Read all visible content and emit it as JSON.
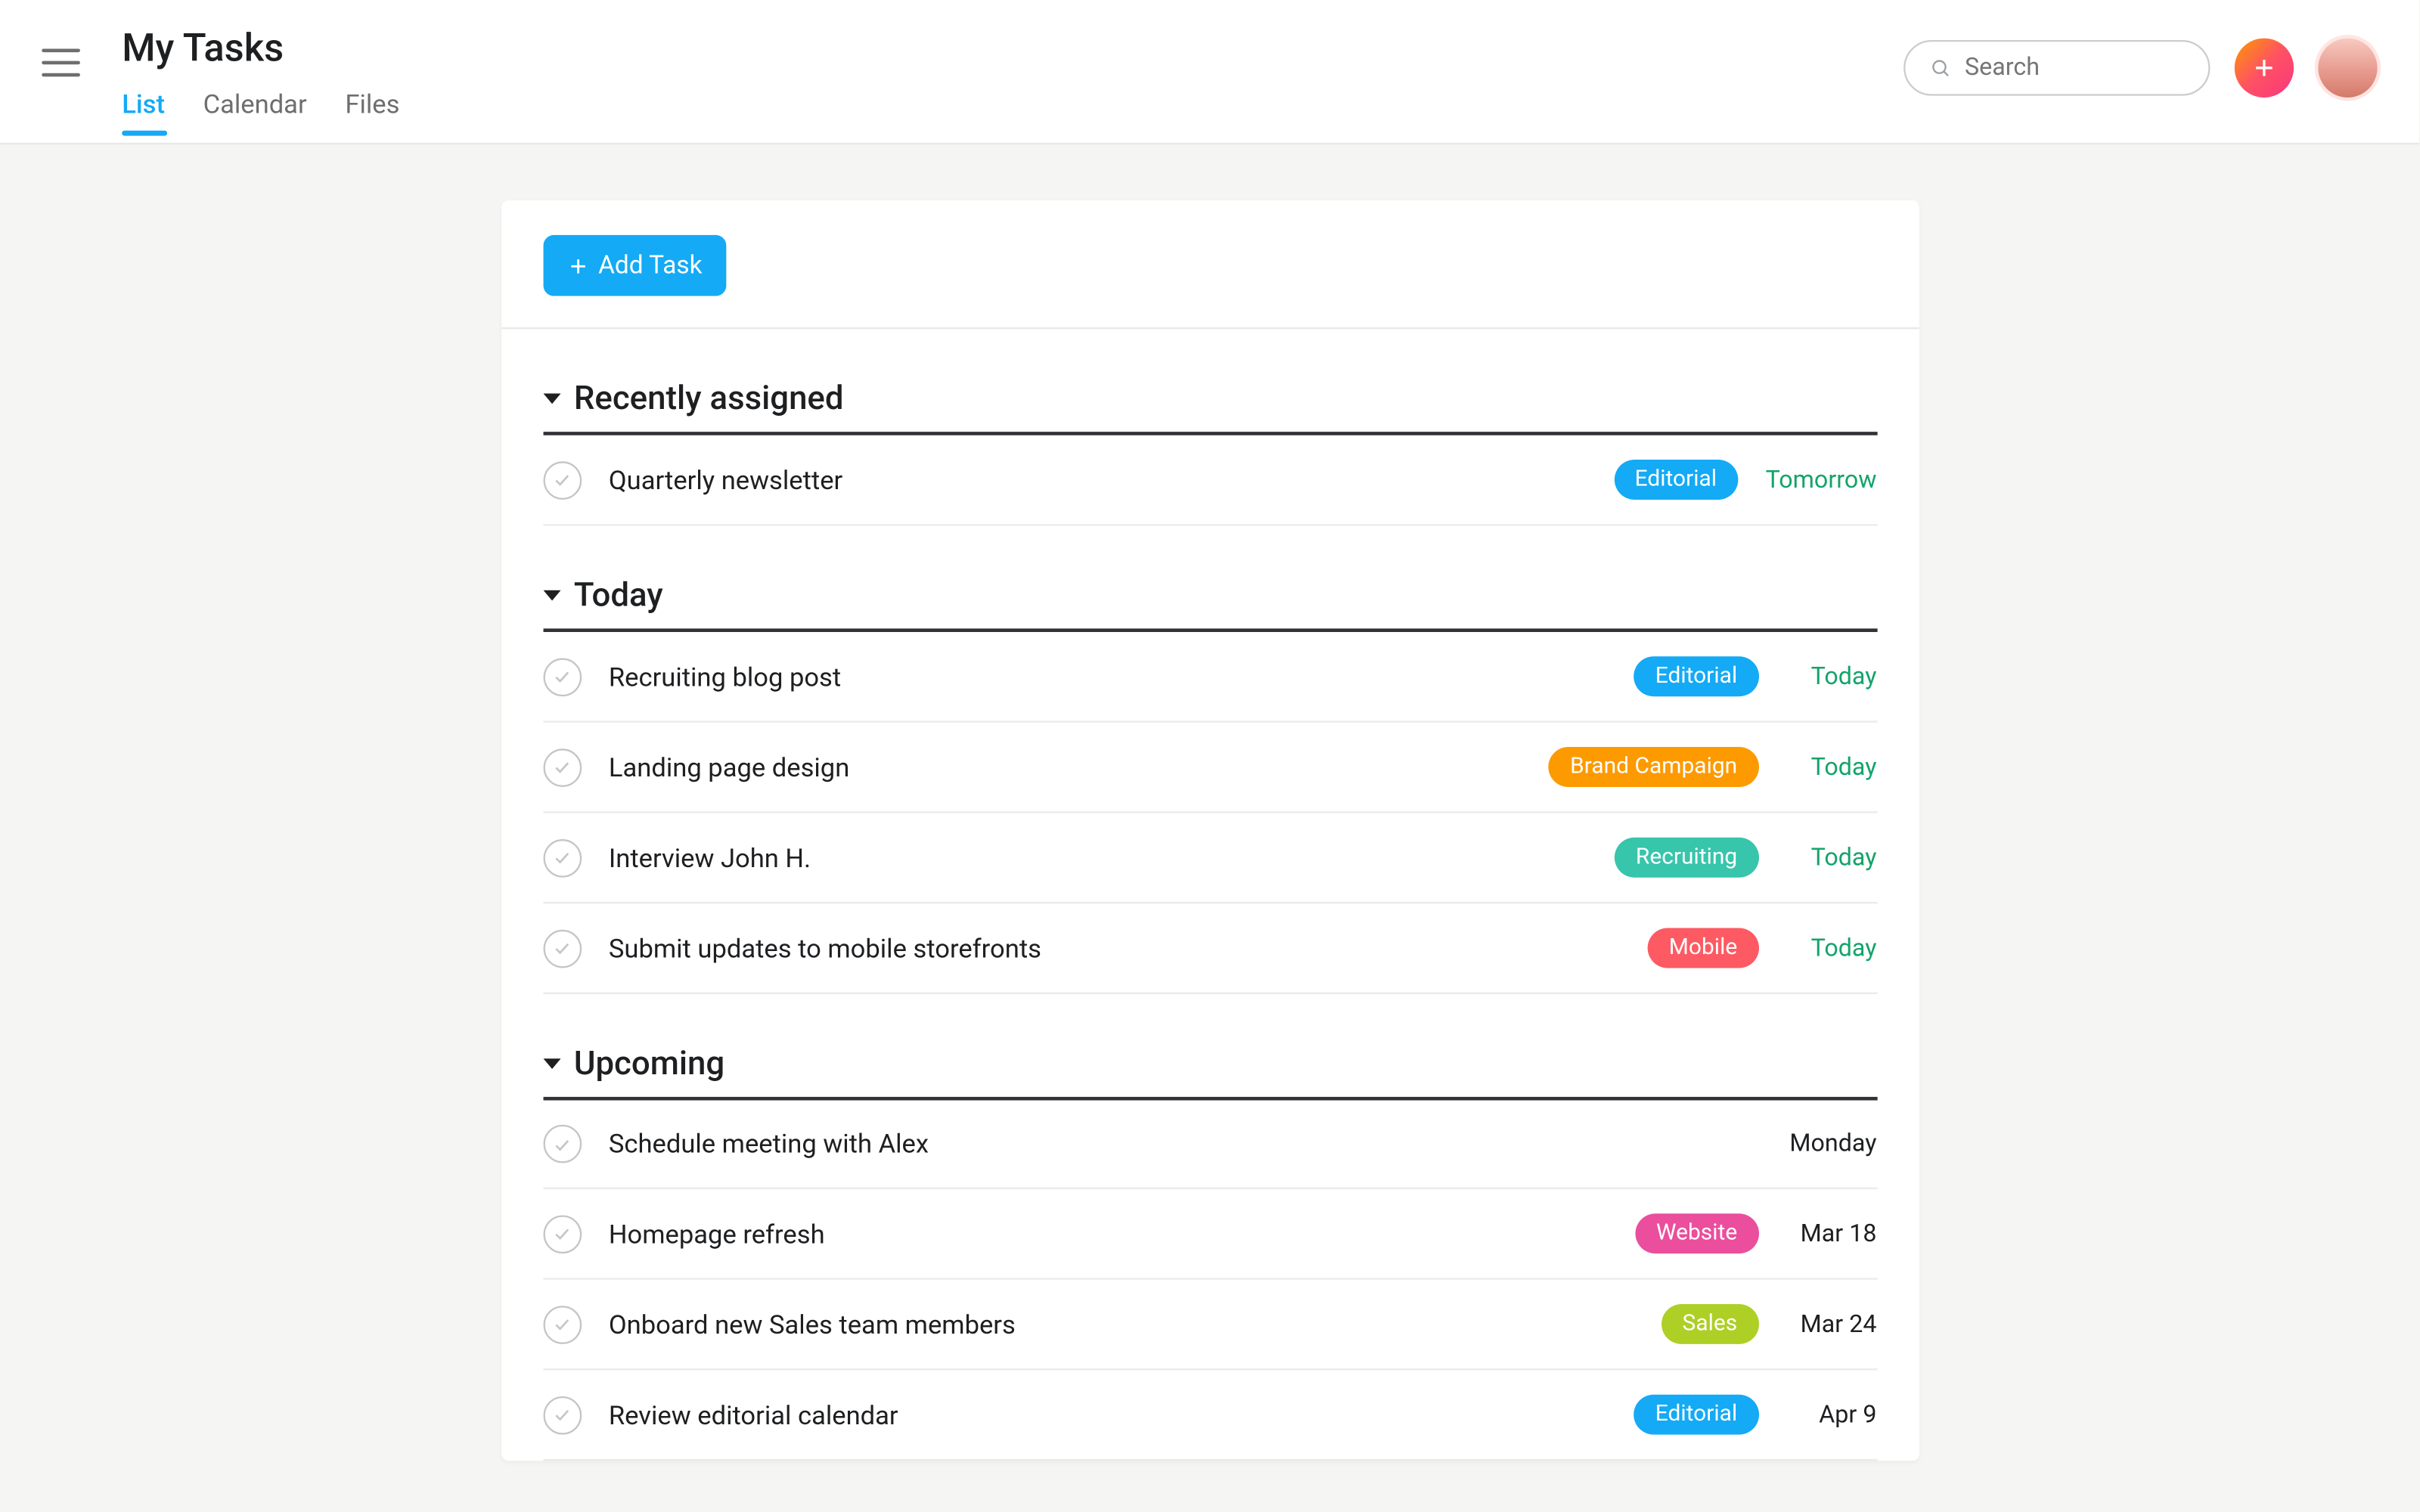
{
  "header": {
    "title": "My Tasks",
    "tabs": [
      "List",
      "Calendar",
      "Files"
    ],
    "active_tab": 0
  },
  "search": {
    "placeholder": "Search"
  },
  "add_task_label": "Add Task",
  "tag_colors": {
    "Editorial": "#14aaf5",
    "Brand Campaign": "#fd9a00",
    "Recruiting": "#37c5ab",
    "Mobile": "#fd5a63",
    "Website": "#ea4e9d",
    "Sales": "#aecf25"
  },
  "sections": [
    {
      "title": "Recently assigned",
      "tasks": [
        {
          "name": "Quarterly newsletter",
          "tag": "Editorial",
          "due": "Tomorrow",
          "due_style": "future"
        }
      ]
    },
    {
      "title": "Today",
      "tasks": [
        {
          "name": "Recruiting blog post",
          "tag": "Editorial",
          "due": "Today",
          "due_style": "future"
        },
        {
          "name": "Landing page design",
          "tag": "Brand Campaign",
          "due": "Today",
          "due_style": "future"
        },
        {
          "name": "Interview John H.",
          "tag": "Recruiting",
          "due": "Today",
          "due_style": "future"
        },
        {
          "name": "Submit updates to mobile storefronts",
          "tag": "Mobile",
          "due": "Today",
          "due_style": "future"
        }
      ]
    },
    {
      "title": "Upcoming",
      "tasks": [
        {
          "name": "Schedule meeting with Alex",
          "tag": null,
          "due": "Monday",
          "due_style": "plain"
        },
        {
          "name": "Homepage refresh",
          "tag": "Website",
          "due": "Mar 18",
          "due_style": "plain"
        },
        {
          "name": "Onboard new Sales team members",
          "tag": "Sales",
          "due": "Mar 24",
          "due_style": "plain"
        },
        {
          "name": "Review editorial calendar",
          "tag": "Editorial",
          "due": "Apr 9",
          "due_style": "plain"
        }
      ]
    }
  ]
}
